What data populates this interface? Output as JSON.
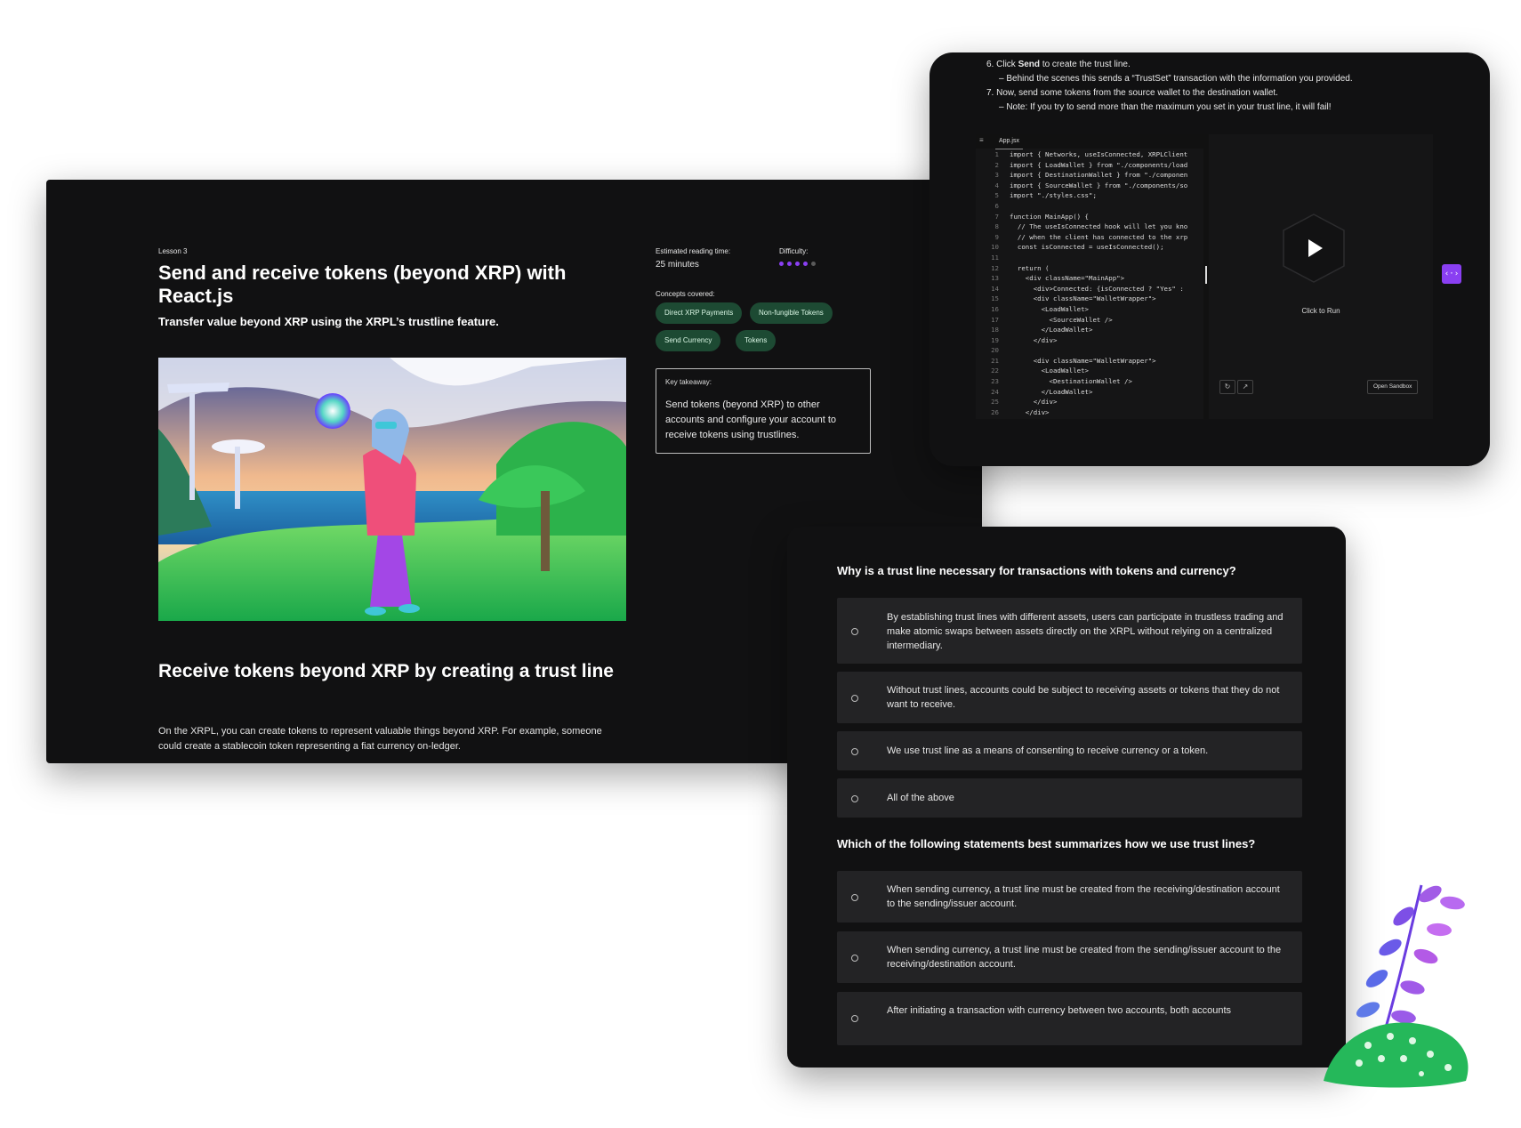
{
  "lesson": {
    "eyebrow": "Lesson 3",
    "title": "Send and receive tokens (beyond XRP) with React.js",
    "subtitle": "Transfer value beyond XRP using the XRPL’s trustline feature.",
    "reading_time_label": "Estimated reading time:",
    "reading_time_value": "25 minutes",
    "difficulty_label": "Difficulty:",
    "difficulty_level": 4,
    "difficulty_max": 5,
    "concepts_label": "Concepts covered:",
    "concepts": [
      "Direct XRP Payments",
      "Non-fungible Tokens",
      "Send Currency",
      "Tokens"
    ],
    "takeaway_label": "Key takeaway:",
    "takeaway_text": "Send tokens (beyond XRP) to other accounts and configure your account to receive tokens using trustlines.",
    "section_heading": "Receive tokens beyond XRP by creating a trust line",
    "section_body": "On the XRPL, you can create tokens to represent valuable things beyond XRP. For example, someone could create a stablecoin token representing a fiat currency on-ledger."
  },
  "code_card": {
    "step6_num": "6.",
    "step6_pre": "Click",
    "step6_bold": "Send",
    "step6_post": "to create the trust line.",
    "step6_sub": "– Behind the scenes this sends a “TrustSet” transaction with the information you provided.",
    "step7": "7. Now, send some tokens from the source wallet to the destination wallet.",
    "step7_sub": "– Note: If you try to send more than the maximum you set in your trust line, it will fail!",
    "tab_name": "App.jsx",
    "menu_icon": "≡",
    "code_lines": [
      {
        "n": "1",
        "t": "import { Networks, useIsConnected, XRPLClient"
      },
      {
        "n": "2",
        "t": "import { LoadWallet } from \"./components/load"
      },
      {
        "n": "3",
        "t": "import { DestinationWallet } from \"./componen"
      },
      {
        "n": "4",
        "t": "import { SourceWallet } from \"./components/so"
      },
      {
        "n": "5",
        "t": "import \"./styles.css\";"
      },
      {
        "n": "6",
        "t": ""
      },
      {
        "n": "7",
        "t": "function MainApp() {"
      },
      {
        "n": "8",
        "t": "  // The useIsConnected hook will let you kno"
      },
      {
        "n": "9",
        "t": "  // when the client has connected to the xrp"
      },
      {
        "n": "10",
        "t": "  const isConnected = useIsConnected();"
      },
      {
        "n": "11",
        "t": ""
      },
      {
        "n": "12",
        "t": "  return ("
      },
      {
        "n": "13",
        "t": "    <div className=\"MainApp\">"
      },
      {
        "n": "14",
        "t": "      <div>Connected: {isConnected ? \"Yes\" :"
      },
      {
        "n": "15",
        "t": "      <div className=\"WalletWrapper\">"
      },
      {
        "n": "16",
        "t": "        <LoadWallet>"
      },
      {
        "n": "17",
        "t": "          <SourceWallet />"
      },
      {
        "n": "18",
        "t": "        </LoadWallet>"
      },
      {
        "n": "19",
        "t": "      </div>"
      },
      {
        "n": "20",
        "t": ""
      },
      {
        "n": "21",
        "t": "      <div className=\"WalletWrapper\">"
      },
      {
        "n": "22",
        "t": "        <LoadWallet>"
      },
      {
        "n": "23",
        "t": "          <DestinationWallet />"
      },
      {
        "n": "24",
        "t": "        </LoadWallet>"
      },
      {
        "n": "25",
        "t": "      </div>"
      },
      {
        "n": "26",
        "t": "    </div>"
      }
    ],
    "run_label": "Click to Run",
    "refresh_icon": "↻",
    "external_icon": "↗",
    "open_sandbox": "Open Sandbox",
    "toggle_icon": "‹·›"
  },
  "quiz": {
    "q1": "Why is a trust line necessary for transactions with tokens and currency?",
    "q1_options": [
      "By establishing trust lines with different assets, users can participate in trustless trading and make atomic swaps between assets directly on the XRPL without relying on a centralized intermediary.",
      "Without trust lines, accounts could be subject to receiving assets or tokens that they do not want to receive.",
      "We use trust line as a means of consenting to receive currency or a token.",
      "All of the above"
    ],
    "q2": "Which of the following statements best summarizes how we use trust lines?",
    "q2_options": [
      "When sending currency, a trust line must be created from the receiving/destination account to the sending/issuer account.",
      "When sending currency, a trust line must be created from the sending/issuer account to the receiving/destination account.",
      "After initiating a transaction with currency between two accounts, both accounts"
    ]
  },
  "colors": {
    "card_bg": "#111112",
    "pill_bg": "#1d4a33",
    "difficulty_on": "#8a3ff2",
    "difficulty_off": "#5a5a5a",
    "accent_purple": "#8a3ff2",
    "option_bg": "#232325"
  }
}
